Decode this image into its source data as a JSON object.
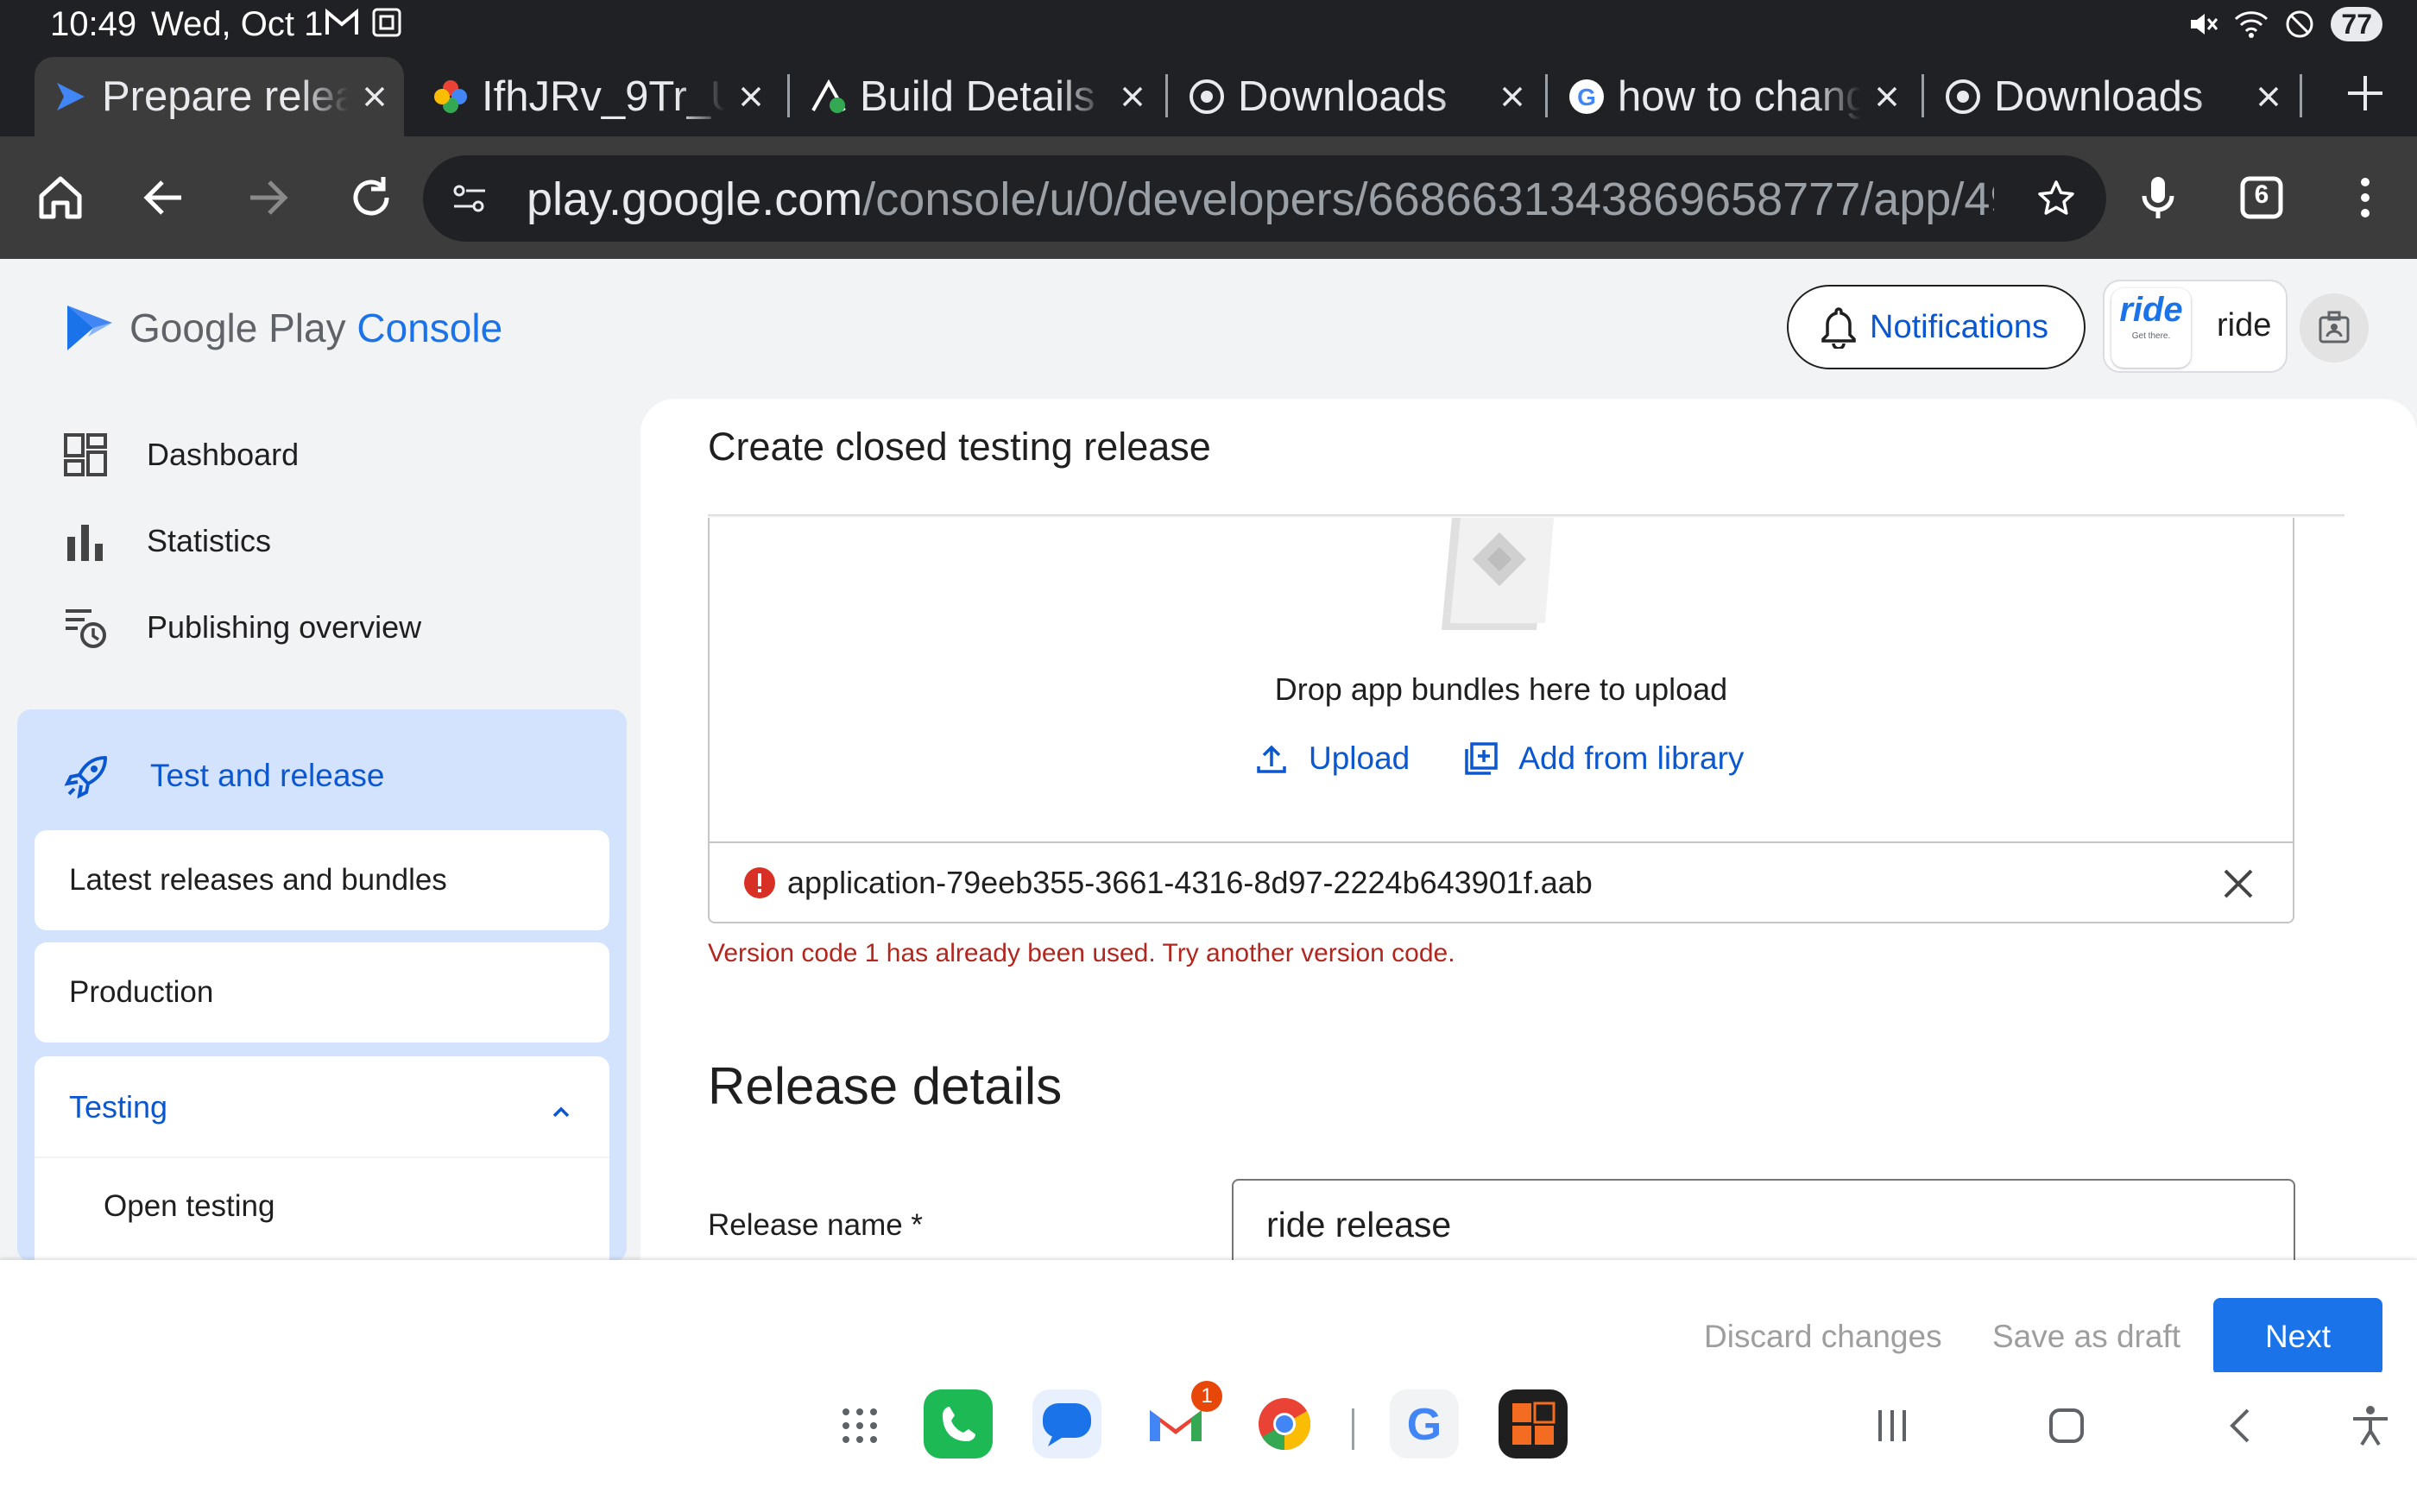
{
  "status_bar": {
    "time": "10:49",
    "date": "Wed, Oct 1",
    "battery": "77"
  },
  "tabs": [
    {
      "title": "Prepare relea",
      "icon": "play-console-icon",
      "active": true
    },
    {
      "title": "IfhJRv_9Tr_Uc",
      "icon": "google-photos-icon"
    },
    {
      "title": "Build Details",
      "icon": "expo-icon"
    },
    {
      "title": "Downloads",
      "icon": "chrome-downloads-icon"
    },
    {
      "title": "how to chang",
      "icon": "google-icon"
    },
    {
      "title": "Downloads",
      "icon": "chrome-downloads-icon"
    }
  ],
  "toolbar": {
    "url_host": "play.google.com",
    "url_path": "/console/u/0/developers/6686631343869658777/app/4975",
    "tab_count": "6"
  },
  "console": {
    "logo_google": "Google Play",
    "logo_console": "Console",
    "notifications_label": "Notifications",
    "app_logo_text": "ride",
    "app_logo_tagline": "Get there.",
    "app_name": "ride"
  },
  "sidebar": {
    "items": [
      {
        "label": "Dashboard",
        "icon": "dashboard-icon"
      },
      {
        "label": "Statistics",
        "icon": "bar-chart-icon"
      },
      {
        "label": "Publishing overview",
        "icon": "publishing-overview-icon"
      }
    ],
    "section_label": "Test and release",
    "sub_items": [
      "Latest releases and bundles",
      "Production"
    ],
    "testing_label": "Testing",
    "testing_children": [
      "Open testing"
    ]
  },
  "main": {
    "title": "Create closed testing release",
    "drop_text": "Drop app bundles here to upload",
    "upload_label": "Upload",
    "add_library_label": "Add from library",
    "file_name": "application-79eeb355-3661-4316-8d97-2224b643901f.aab",
    "error_message": "Version code 1 has already been used. Try another version code.",
    "release_details_title": "Release details",
    "release_name_label": "Release name  *",
    "release_name_value": "ride release"
  },
  "actions": {
    "discard": "Discard changes",
    "save_draft": "Save as draft",
    "next": "Next"
  },
  "dock": {
    "gmail_badge": "1",
    "apps": [
      "app-drawer-icon",
      "phone-icon",
      "messages-icon",
      "gmail-icon",
      "chrome-icon",
      "google-icon",
      "app-icon"
    ]
  },
  "colors": {
    "accent": "#1a73e8",
    "error": "#b3261e",
    "sidebar_active": "#d3e3fd"
  }
}
